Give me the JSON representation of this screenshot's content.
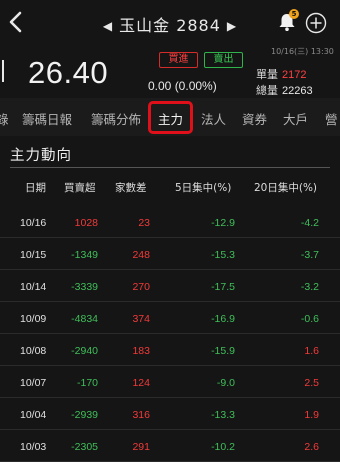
{
  "header": {
    "stock_name": "玉山金",
    "stock_code": "2884",
    "prev_arrow": "◀",
    "next_arrow": "▶",
    "notification_count": "5"
  },
  "quote": {
    "price": "26.40",
    "buy_label": "買進",
    "sell_label": "賣出",
    "change": "0.00 (0.00%)",
    "datetime": "10/16(三) 13:30",
    "unit_label": "單量",
    "unit_value": "2172",
    "total_label": "總量",
    "total_value": "22263"
  },
  "tabs": [
    "錄",
    "籌碼日報",
    "籌碼分佈",
    "主力",
    "法人",
    "資券",
    "大戶",
    "營"
  ],
  "active_tab": "主力",
  "section": {
    "title": "主力動向"
  },
  "table": {
    "headers": {
      "date": "日期",
      "net": "買賣超",
      "diff": "家數差",
      "c5": "5日集中(%)",
      "c20": "20日集中(%)"
    },
    "rows": [
      {
        "date": "10/16",
        "net": "1028",
        "diff": "23",
        "c5": "-12.9",
        "c20": "-4.2"
      },
      {
        "date": "10/15",
        "net": "-1349",
        "diff": "248",
        "c5": "-15.3",
        "c20": "-3.7"
      },
      {
        "date": "10/14",
        "net": "-3339",
        "diff": "270",
        "c5": "-17.5",
        "c20": "-3.2"
      },
      {
        "date": "10/09",
        "net": "-4834",
        "diff": "374",
        "c5": "-16.9",
        "c20": "-0.6"
      },
      {
        "date": "10/08",
        "net": "-2940",
        "diff": "183",
        "c5": "-15.9",
        "c20": "1.6"
      },
      {
        "date": "10/07",
        "net": "-170",
        "diff": "124",
        "c5": "-9.0",
        "c20": "2.5"
      },
      {
        "date": "10/04",
        "net": "-2939",
        "diff": "316",
        "c5": "-13.3",
        "c20": "1.9"
      },
      {
        "date": "10/03",
        "net": "-2305",
        "diff": "291",
        "c5": "-10.2",
        "c20": "2.6"
      }
    ]
  },
  "colors": {
    "up": "#f23a3a",
    "down": "#3fbf5a",
    "highlight": "#e0101a",
    "badge": "#f0a21a"
  }
}
